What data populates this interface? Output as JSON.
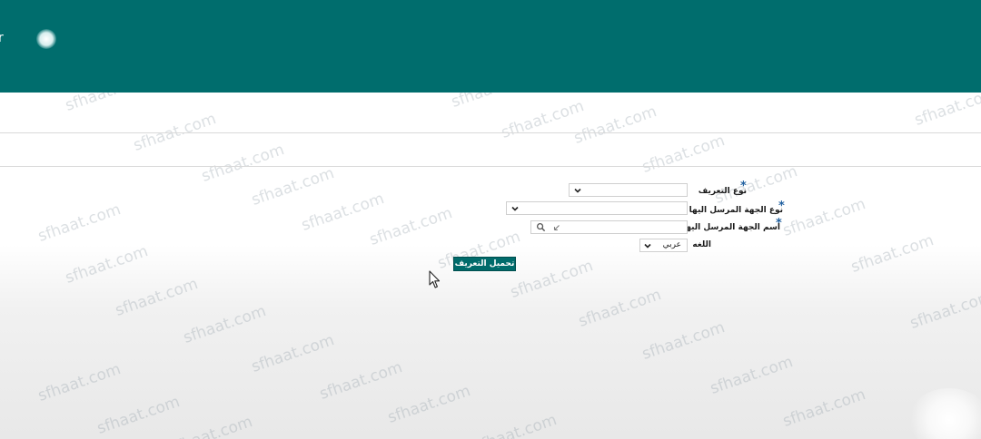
{
  "header": {
    "left_glyph": "r",
    "avatar": "user-avatar"
  },
  "form": {
    "fields": [
      {
        "label": "نوع التعريف",
        "required": true,
        "type": "select",
        "value": ""
      },
      {
        "label": "نوع الجهة المرسل اليها",
        "required": true,
        "type": "select",
        "value": ""
      },
      {
        "label": "اسم الجهة المرسل اليها",
        "required": true,
        "type": "lookup",
        "value": ""
      },
      {
        "label": "اللغه",
        "required": false,
        "type": "select",
        "value": "عربي"
      }
    ],
    "required_mark": "*",
    "submit_label": "تحميل التعريف"
  },
  "icons": {
    "chevron": "chevron-down-icon",
    "search": "search-icon",
    "clear": "clear-icon",
    "cursor": "mouse-pointer-icon"
  },
  "watermark": "sfhaat.com",
  "colors": {
    "header": "#006d6d",
    "button": "#006b6b",
    "required_star": "#1f5f9f"
  }
}
